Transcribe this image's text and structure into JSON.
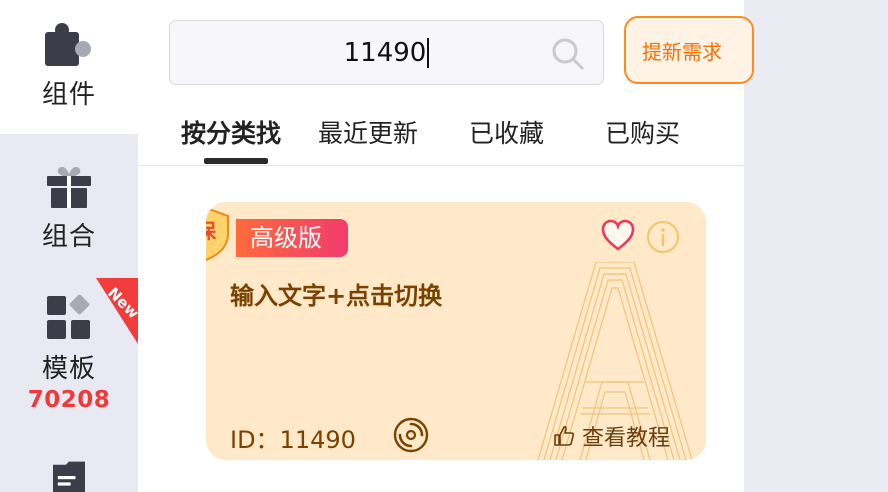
{
  "sidebar": {
    "items": [
      {
        "label": "组件",
        "icon": "puzzle-icon",
        "active": true
      },
      {
        "label": "组合",
        "icon": "gift-icon"
      },
      {
        "label": "模板",
        "icon": "grid-icon",
        "count": "70208",
        "ribbon": "New"
      },
      {
        "label": "",
        "icon": "document-icon"
      }
    ]
  },
  "search": {
    "value": "11490",
    "placeholder": ""
  },
  "need_button": {
    "label": "提新需求"
  },
  "tabs": [
    {
      "label": "按分类找",
      "active": true
    },
    {
      "label": "最近更新"
    },
    {
      "label": "已收藏"
    },
    {
      "label": "已购买"
    }
  ],
  "card": {
    "badge": "高级版",
    "seal_text": "保",
    "title": "输入文字+点击切换",
    "id_text": "ID：11490",
    "tutorial": "查看教程"
  },
  "colors": {
    "accent": "#ff6e00",
    "badge_gradient": [
      "#ff6a3d",
      "#f23b6e"
    ],
    "card_bg": "#ffe9c9",
    "ribbon": "#f23c3c",
    "count": "#ee3a3a"
  }
}
